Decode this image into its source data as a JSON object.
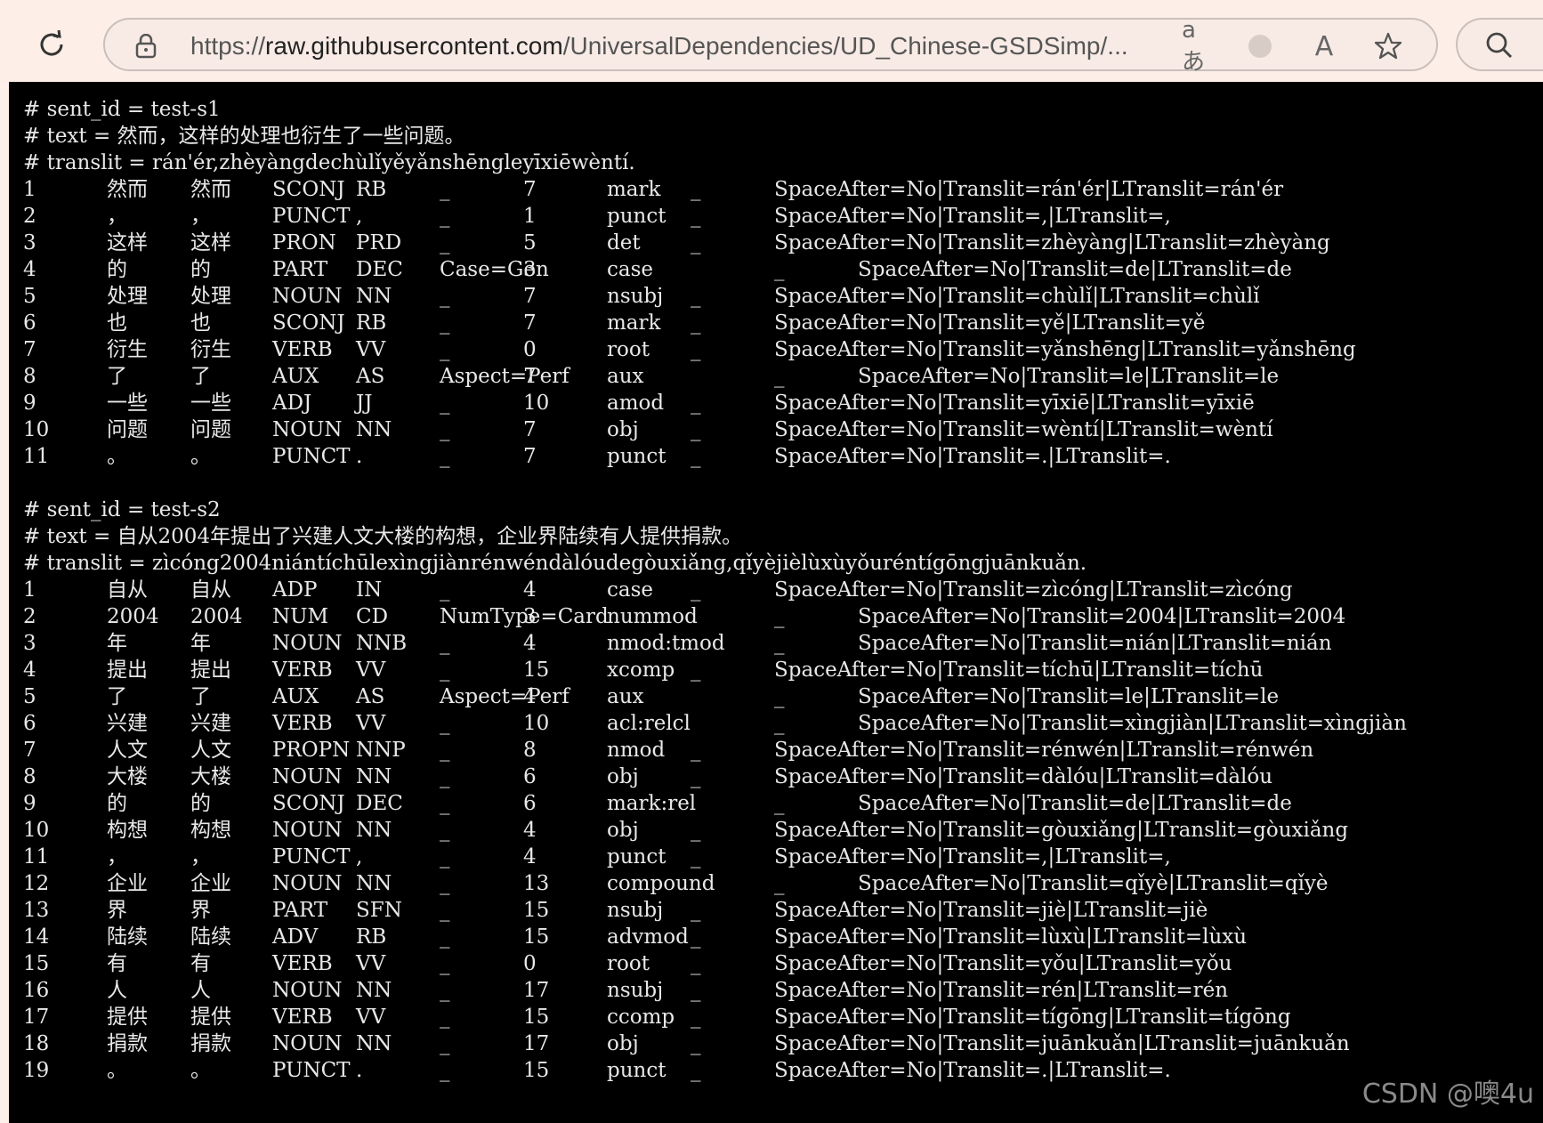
{
  "browser": {
    "url_prefix": "https://",
    "url_host": "raw.githubusercontent.com",
    "url_path": "/UniversalDependencies/UD_Chinese-GSDSimp/...",
    "read_aloud_glyph": "aあ",
    "text_size_glyph": "A"
  },
  "doc": {
    "s1_comments": [
      "# sent_id = test-s1",
      "# text = 然而，这样的处理也衍生了一些问题。",
      "# translit = rán'ér,zhèyàngdechùlǐyěyǎnshēngleyīxiēwèntí."
    ],
    "s1_rows": [
      [
        "1",
        "然而",
        "然而",
        "SCONJ",
        "RB",
        "_",
        "7",
        "mark",
        "_",
        "SpaceAfter=No|Translit=rán'ér|LTranslit=rán'ér"
      ],
      [
        "2",
        "，",
        "，",
        "PUNCT",
        ",",
        "_",
        "1",
        "punct",
        "_",
        "SpaceAfter=No|Translit=,|LTranslit=,"
      ],
      [
        "3",
        "这样",
        "这样",
        "PRON",
        "PRD",
        "_",
        "5",
        "det",
        "_",
        "SpaceAfter=No|Translit=zhèyàng|LTranslit=zhèyàng"
      ],
      [
        "4",
        "的",
        "的",
        "PART",
        "DEC",
        "Case=Gen",
        "3",
        "case",
        "_",
        "SpaceAfter=No|Translit=de|LTranslit=de"
      ],
      [
        "5",
        "处理",
        "处理",
        "NOUN",
        "NN",
        "_",
        "7",
        "nsubj",
        "_",
        "SpaceAfter=No|Translit=chùlǐ|LTranslit=chùlǐ"
      ],
      [
        "6",
        "也",
        "也",
        "SCONJ",
        "RB",
        "_",
        "7",
        "mark",
        "_",
        "SpaceAfter=No|Translit=yě|LTranslit=yě"
      ],
      [
        "7",
        "衍生",
        "衍生",
        "VERB",
        "VV",
        "_",
        "0",
        "root",
        "_",
        "SpaceAfter=No|Translit=yǎnshēng|LTranslit=yǎnshēng"
      ],
      [
        "8",
        "了",
        "了",
        "AUX",
        "AS",
        "Aspect=Perf",
        "7",
        "aux",
        "_",
        "SpaceAfter=No|Translit=le|LTranslit=le"
      ],
      [
        "9",
        "一些",
        "一些",
        "ADJ",
        "JJ",
        "_",
        "10",
        "amod",
        "_",
        "SpaceAfter=No|Translit=yīxiē|LTranslit=yīxiē"
      ],
      [
        "10",
        "问题",
        "问题",
        "NOUN",
        "NN",
        "_",
        "7",
        "obj",
        "_",
        "SpaceAfter=No|Translit=wèntí|LTranslit=wèntí"
      ],
      [
        "11",
        "。",
        "。",
        "PUNCT",
        ".",
        "_",
        "7",
        "punct",
        "_",
        "SpaceAfter=No|Translit=.|LTranslit=."
      ]
    ],
    "s2_comments": [
      "# sent_id = test-s2",
      "# text = 自从2004年提出了兴建人文大楼的构想，企业界陆续有人提供捐款。",
      "# translit = zìcóng2004niántíchūlexìngjiànrénwéndàlóudegòuxiǎng,qǐyèjièlùxùyǒuréntígōngjuānkuǎn."
    ],
    "s2_rows": [
      [
        "1",
        "自从",
        "自从",
        "ADP",
        "IN",
        "_",
        "4",
        "case",
        "_",
        "SpaceAfter=No|Translit=zìcóng|LTranslit=zìcóng"
      ],
      [
        "2",
        "2004",
        "2004",
        "NUM",
        "CD",
        "NumType=Card",
        "3",
        "nummod",
        "_",
        "SpaceAfter=No|Translit=2004|LTranslit=2004"
      ],
      [
        "3",
        "年",
        "年",
        "NOUN",
        "NNB",
        "_",
        "4",
        "nmod:tmod",
        "_",
        "SpaceAfter=No|Translit=nián|LTranslit=nián"
      ],
      [
        "4",
        "提出",
        "提出",
        "VERB",
        "VV",
        "_",
        "15",
        "xcomp",
        "_",
        "SpaceAfter=No|Translit=tíchū|LTranslit=tíchū"
      ],
      [
        "5",
        "了",
        "了",
        "AUX",
        "AS",
        "Aspect=Perf",
        "4",
        "aux",
        "_",
        "SpaceAfter=No|Translit=le|LTranslit=le"
      ],
      [
        "6",
        "兴建",
        "兴建",
        "VERB",
        "VV",
        "_",
        "10",
        "acl:relcl",
        "_",
        "SpaceAfter=No|Translit=xìngjiàn|LTranslit=xìngjiàn"
      ],
      [
        "7",
        "人文",
        "人文",
        "PROPN",
        "NNP",
        "_",
        "8",
        "nmod",
        "_",
        "SpaceAfter=No|Translit=rénwén|LTranslit=rénwén"
      ],
      [
        "8",
        "大楼",
        "大楼",
        "NOUN",
        "NN",
        "_",
        "6",
        "obj",
        "_",
        "SpaceAfter=No|Translit=dàlóu|LTranslit=dàlóu"
      ],
      [
        "9",
        "的",
        "的",
        "SCONJ",
        "DEC",
        "_",
        "6",
        "mark:rel",
        "_",
        "SpaceAfter=No|Translit=de|LTranslit=de"
      ],
      [
        "10",
        "构想",
        "构想",
        "NOUN",
        "NN",
        "_",
        "4",
        "obj",
        "_",
        "SpaceAfter=No|Translit=gòuxiǎng|LTranslit=gòuxiǎng"
      ],
      [
        "11",
        "，",
        "，",
        "PUNCT",
        ",",
        "_",
        "4",
        "punct",
        "_",
        "SpaceAfter=No|Translit=,|LTranslit=,"
      ],
      [
        "12",
        "企业",
        "企业",
        "NOUN",
        "NN",
        "_",
        "13",
        "compound",
        "_",
        "SpaceAfter=No|Translit=qǐyè|LTranslit=qǐyè"
      ],
      [
        "13",
        "界",
        "界",
        "PART",
        "SFN",
        "_",
        "15",
        "nsubj",
        "_",
        "SpaceAfter=No|Translit=jiè|LTranslit=jiè"
      ],
      [
        "14",
        "陆续",
        "陆续",
        "ADV",
        "RB",
        "_",
        "15",
        "advmod",
        "_",
        "SpaceAfter=No|Translit=lùxù|LTranslit=lùxù"
      ],
      [
        "15",
        "有",
        "有",
        "VERB",
        "VV",
        "_",
        "0",
        "root",
        "_",
        "SpaceAfter=No|Translit=yǒu|LTranslit=yǒu"
      ],
      [
        "16",
        "人",
        "人",
        "NOUN",
        "NN",
        "_",
        "17",
        "nsubj",
        "_",
        "SpaceAfter=No|Translit=rén|LTranslit=rén"
      ],
      [
        "17",
        "提供",
        "提供",
        "VERB",
        "VV",
        "_",
        "15",
        "ccomp",
        "_",
        "SpaceAfter=No|Translit=tígōng|LTranslit=tígōng"
      ],
      [
        "18",
        "捐款",
        "捐款",
        "NOUN",
        "NN",
        "_",
        "17",
        "obj",
        "_",
        "SpaceAfter=No|Translit=juānkuǎn|LTranslit=juānkuǎn"
      ],
      [
        "19",
        "。",
        "。",
        "PUNCT",
        ".",
        "_",
        "15",
        "punct",
        "_",
        "SpaceAfter=No|Translit=.|LTranslit=."
      ]
    ]
  },
  "watermark": "CSDN @噢4u"
}
